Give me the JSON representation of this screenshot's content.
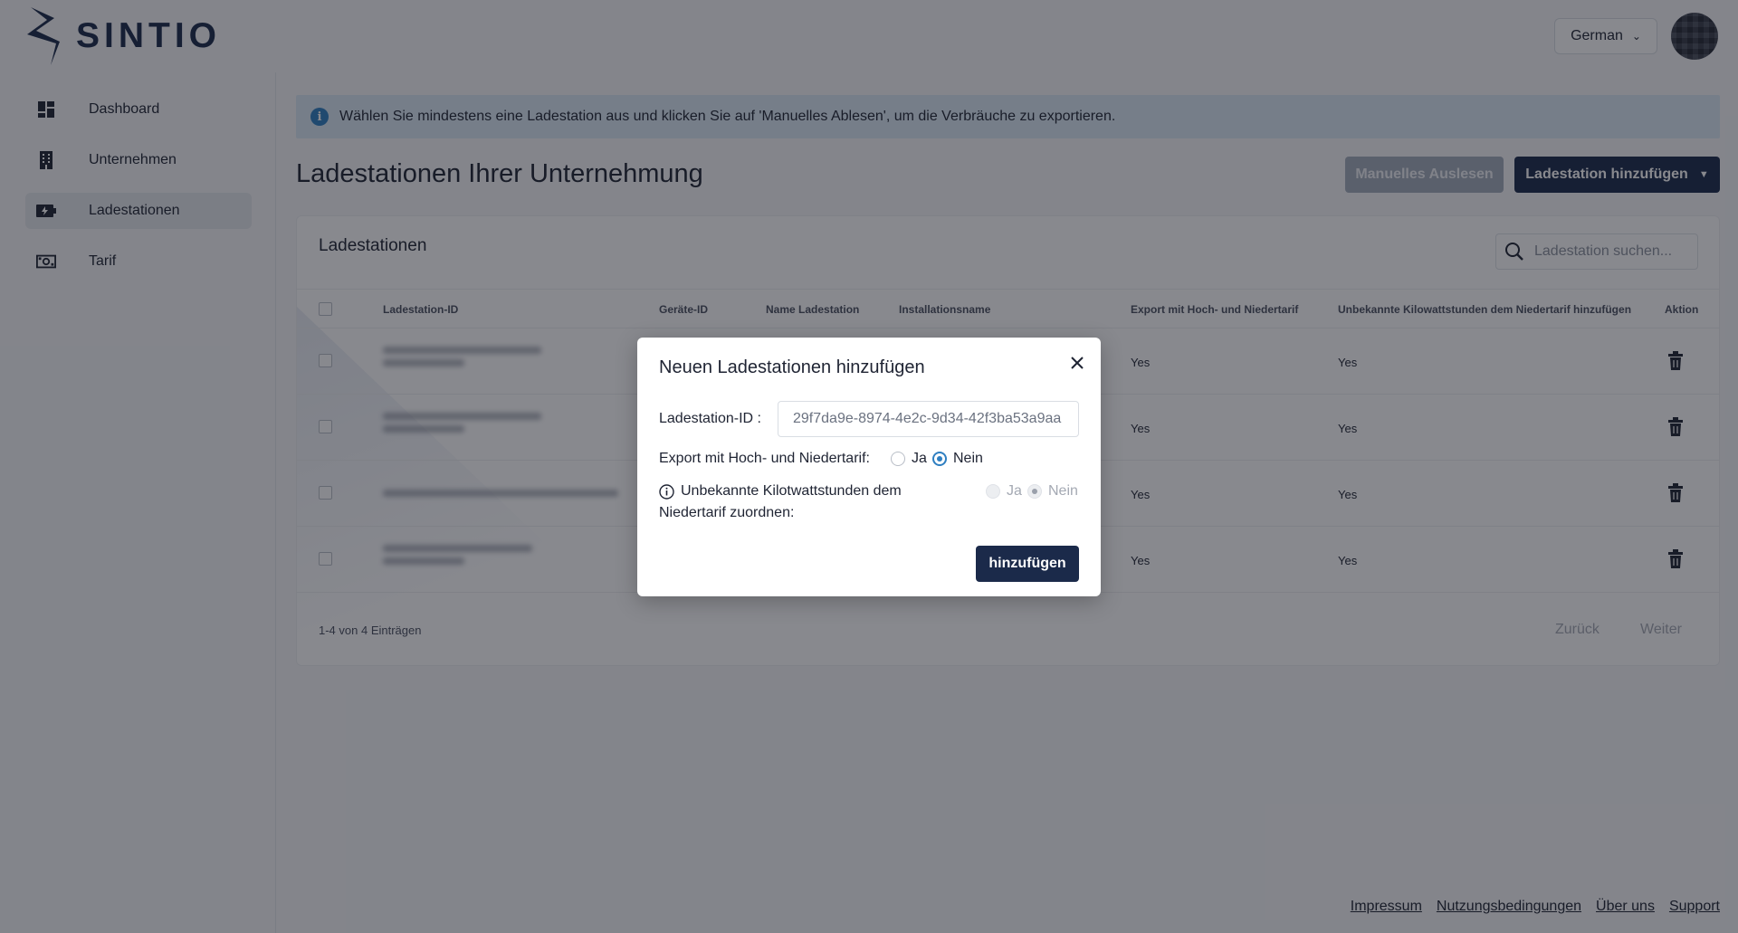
{
  "header": {
    "brand": "SINTIO",
    "language": "German"
  },
  "sidebar": {
    "items": [
      {
        "label": "Dashboard",
        "icon": "dashboard-icon"
      },
      {
        "label": "Unternehmen",
        "icon": "building-icon"
      },
      {
        "label": "Ladestationen",
        "icon": "charging-station-icon",
        "active": true
      },
      {
        "label": "Tarif",
        "icon": "money-icon"
      }
    ]
  },
  "info_bar": {
    "text": "Wählen Sie mindestens eine Ladestation aus und klicken Sie auf 'Manuelles Ablesen', um die Verbräuche zu exportieren."
  },
  "page": {
    "title": "Ladestationen Ihrer Unternehmung",
    "manual_read_button": "Manuelles Auslesen",
    "add_button": "Ladestation hinzufügen"
  },
  "table": {
    "title": "Ladestationen",
    "search_placeholder": "Ladestation suchen...",
    "columns": [
      "Ladestation-ID",
      "Geräte-ID",
      "Name Ladestation",
      "Installationsname",
      "Export mit Hoch- und Niedertarif",
      "Unbekannte Kilowattstunden dem Niedertarif hinzufügen",
      "Aktion"
    ],
    "rows": [
      {
        "export": "Yes",
        "unknown_kwh": "Yes"
      },
      {
        "export": "Yes",
        "unknown_kwh": "Yes"
      },
      {
        "export": "Yes",
        "unknown_kwh": "Yes"
      },
      {
        "export": "Yes",
        "unknown_kwh": "Yes"
      }
    ],
    "count_text": "1-4 von 4 Einträgen",
    "prev": "Zurück",
    "next": "Weiter"
  },
  "footer": {
    "links": [
      "Impressum",
      "Nutzungsbedingungen",
      "Über uns",
      "Support"
    ]
  },
  "modal": {
    "title": "Neuen Ladestationen hinzufügen",
    "id_label": "Ladestation-ID :",
    "id_value": "29f7da9e-8974-4e2c-9d34-42f3ba53a9aa",
    "export_label": "Export mit Hoch- und Niedertarif:",
    "export_options": [
      "Ja",
      "Nein"
    ],
    "export_selected": "Nein",
    "unknown_label_line1": "Unbekannte Kilotwattstunden dem",
    "unknown_label_line2": "Niedertarif zuordnen:",
    "unknown_options": [
      "Ja",
      "Nein"
    ],
    "unknown_selected": "Nein",
    "submit": "hinzufügen"
  },
  "colors": {
    "brand_navy": "#1b2a4a",
    "info_blue": "#2f7fc1"
  }
}
